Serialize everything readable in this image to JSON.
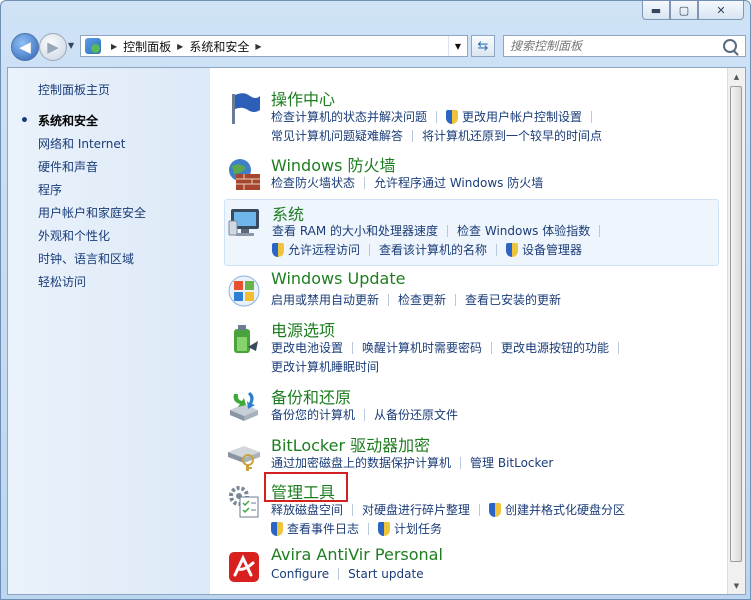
{
  "window": {
    "minimize": "▬",
    "maximize": "▢",
    "close": "✕"
  },
  "nav": {
    "breadcrumb": [
      "控制面板",
      "系统和安全"
    ],
    "search_placeholder": "搜索控制面板"
  },
  "sidebar": {
    "home": "控制面板主页",
    "items": [
      {
        "label": "系统和安全",
        "active": true
      },
      {
        "label": "网络和 Internet"
      },
      {
        "label": "硬件和声音"
      },
      {
        "label": "程序"
      },
      {
        "label": "用户帐户和家庭安全"
      },
      {
        "label": "外观和个性化"
      },
      {
        "label": "时钟、语言和区域"
      },
      {
        "label": "轻松访问"
      }
    ]
  },
  "categories": [
    {
      "title": "操作中心",
      "icon": "flag-icon",
      "rows": [
        [
          "检查计算机的状态并解决问题",
          "更改用户帐户控制设置"
        ],
        [
          "常见计算机问题疑难解答",
          "将计算机还原到一个较早的时间点"
        ]
      ]
    },
    {
      "title": "Windows 防火墙",
      "icon": "firewall-icon",
      "rows": [
        [
          "检查防火墙状态",
          "允许程序通过 Windows 防火墙"
        ]
      ]
    },
    {
      "title": "系统",
      "icon": "system-icon",
      "rows": [
        [
          "查看 RAM 的大小和处理器速度",
          "检查 Windows 体验指数"
        ],
        [
          "允许远程访问",
          "查看该计算机的名称",
          "设备管理器"
        ]
      ]
    },
    {
      "title": "Windows Update",
      "icon": "windows-update-icon",
      "rows": [
        [
          "启用或禁用自动更新",
          "检查更新",
          "查看已安装的更新"
        ]
      ]
    },
    {
      "title": "电源选项",
      "icon": "power-icon",
      "rows": [
        [
          "更改电池设置",
          "唤醒计算机时需要密码",
          "更改电源按钮的功能"
        ],
        [
          "更改计算机睡眠时间"
        ]
      ]
    },
    {
      "title": "备份和还原",
      "icon": "backup-icon",
      "rows": [
        [
          "备份您的计算机",
          "从备份还原文件"
        ]
      ]
    },
    {
      "title": "BitLocker 驱动器加密",
      "icon": "bitlocker-icon",
      "rows": [
        [
          "通过加密磁盘上的数据保护计算机",
          "管理 BitLocker"
        ]
      ]
    },
    {
      "title": "管理工具",
      "icon": "admin-tools-icon",
      "rows": [
        [
          "释放磁盘空间",
          "对硬盘进行碎片整理",
          "创建并格式化硬盘分区"
        ],
        [
          "查看事件日志",
          "计划任务"
        ]
      ]
    },
    {
      "title": "Avira AntiVir Personal",
      "icon": "avira-icon",
      "rows": [
        [
          "Configure",
          "Start update"
        ]
      ]
    }
  ],
  "accent_colors": {
    "title_green": "#1e7d20",
    "link_blue": "#1a3c78",
    "highlight_box": "#d42020"
  }
}
